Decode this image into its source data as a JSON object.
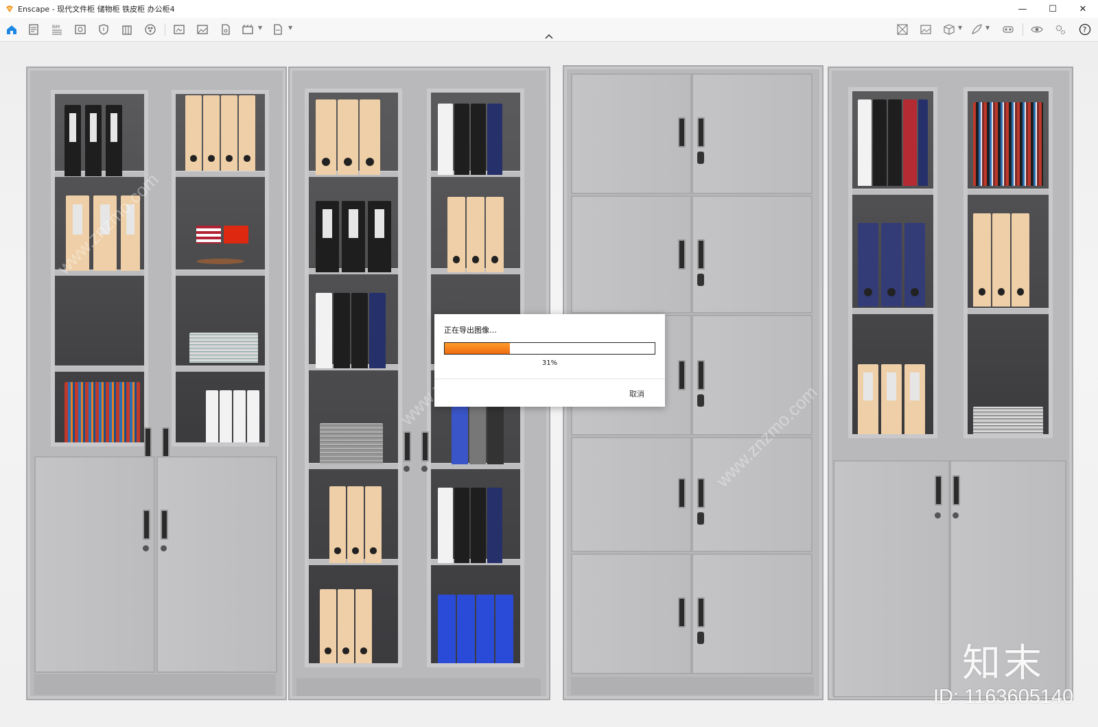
{
  "window": {
    "app_name": "Enscape",
    "title": "Enscape - 现代文件柜 储物柜 铁皮柜 办公柜4",
    "controls": {
      "minimize": "—",
      "maximize": "☐",
      "close": "✕"
    }
  },
  "toolbar": {
    "left_icons": [
      "home-icon",
      "document-icon",
      "bim-icon",
      "view-icon",
      "shield-icon",
      "building-icon",
      "materials-icon",
      "screenshot-icon",
      "image-icon",
      "file-export-icon",
      "video-icon",
      "export-icon"
    ],
    "right_icons": [
      "map-icon",
      "gallery-icon",
      "cube-icon",
      "feather-icon",
      "vr-headset-icon",
      "eye-icon",
      "settings-icon",
      "help-icon"
    ],
    "bim_label": "BIM",
    "help_label": "?"
  },
  "dialog": {
    "message": "正在导出图像…",
    "progress": 31,
    "progress_label": "31%",
    "cancel_label": "取消",
    "progress_color": "#f07414"
  },
  "watermarks": {
    "brand": "知末",
    "id_text": "ID: 1163605140",
    "diagonal": "www.znzmo.com"
  },
  "colors": {
    "accent": "#1e88e5",
    "cabinet": "#bcbcbe",
    "glass_interior": "#444446"
  }
}
